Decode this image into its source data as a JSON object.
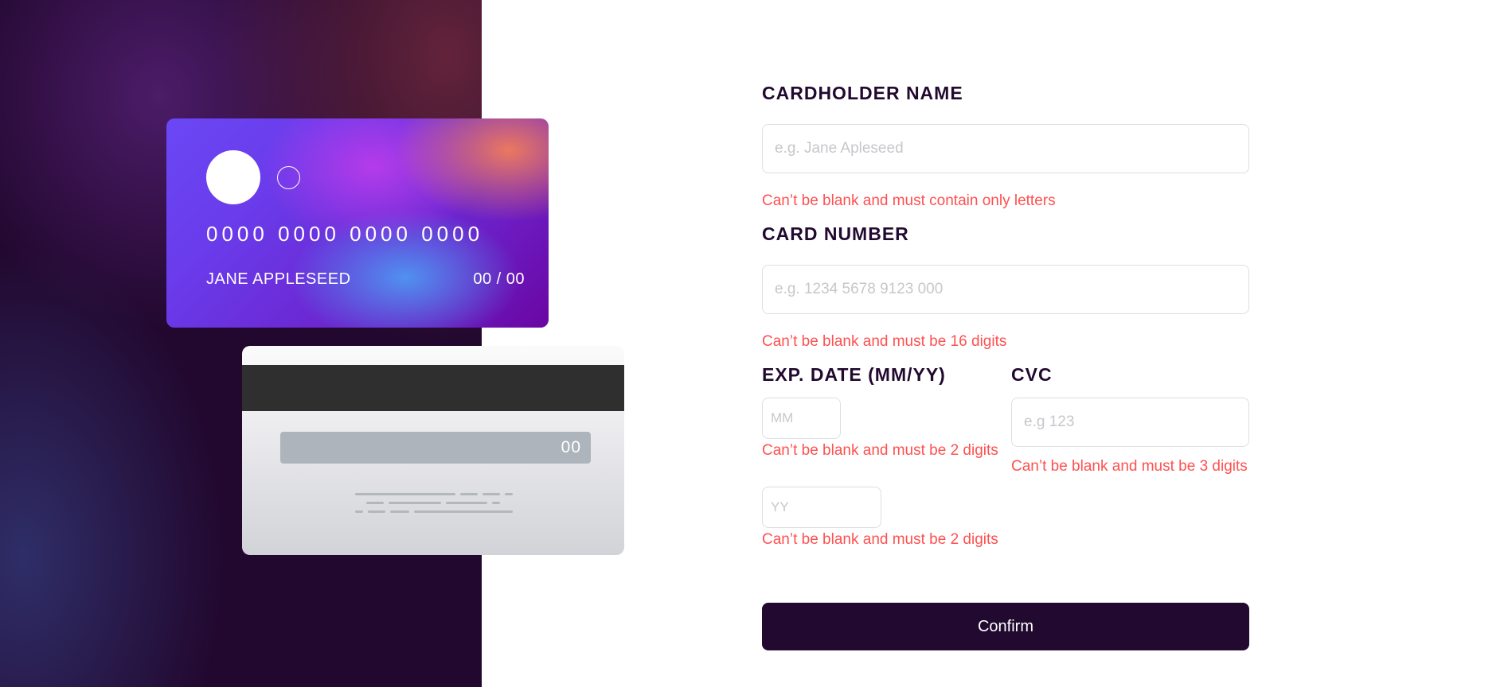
{
  "card_preview": {
    "number": "0000 0000 0000 0000",
    "holder": "JANE APPLESEED",
    "expiry": "00 / 00",
    "cvc": "00"
  },
  "form": {
    "cardholder": {
      "label": "CARDHOLDER NAME",
      "placeholder": "e.g. Jane Apleseed",
      "value": "",
      "error": "Can’t be blank and must contain only letters"
    },
    "card_number": {
      "label": "CARD NUMBER",
      "placeholder": "e.g. 1234 5678 9123 000",
      "value": "",
      "error": "Can’t be blank and must be 16 digits"
    },
    "exp_date": {
      "label": "EXP. DATE (MM/YY)",
      "month_placeholder": "MM",
      "month_error": "Can’t be blank and must be 2 digits",
      "year_placeholder": "YY",
      "year_error": "Can’t be blank and must be 2 digits"
    },
    "cvc": {
      "label": "CVC",
      "placeholder": "e.g 123",
      "value": "",
      "error": "Can’t be blank and must be 3 digits"
    },
    "confirm_label": "Confirm"
  },
  "colors": {
    "accent_dark": "#21092f",
    "error": "#ff5050",
    "input_border": "#dfdee0"
  }
}
